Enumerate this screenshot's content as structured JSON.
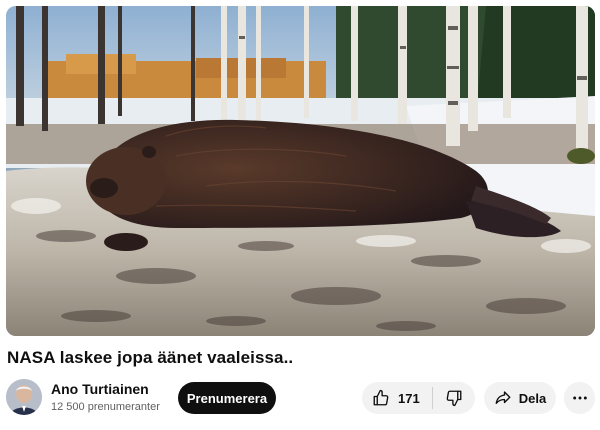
{
  "video": {
    "title": "NASA laskee jopa äänet vaaleissa..",
    "thumbnail_subject": "beaver lying on a birch log in a snowy forest"
  },
  "channel": {
    "name": "Ano Turtiainen",
    "subscribers": "12 500 prenumeranter",
    "subscribe_label": "Prenumerera"
  },
  "actions": {
    "like_count": "171",
    "like_icon": "thumbs-up-icon",
    "dislike_icon": "thumbs-down-icon",
    "share_label": "Dela",
    "share_icon": "share-arrow-icon",
    "more_icon": "more-horizontal-icon"
  },
  "colors": {
    "subscribe_bg": "#0f0f0f",
    "pill_bg": "#f2f2f2",
    "secondary_text": "#606060"
  }
}
